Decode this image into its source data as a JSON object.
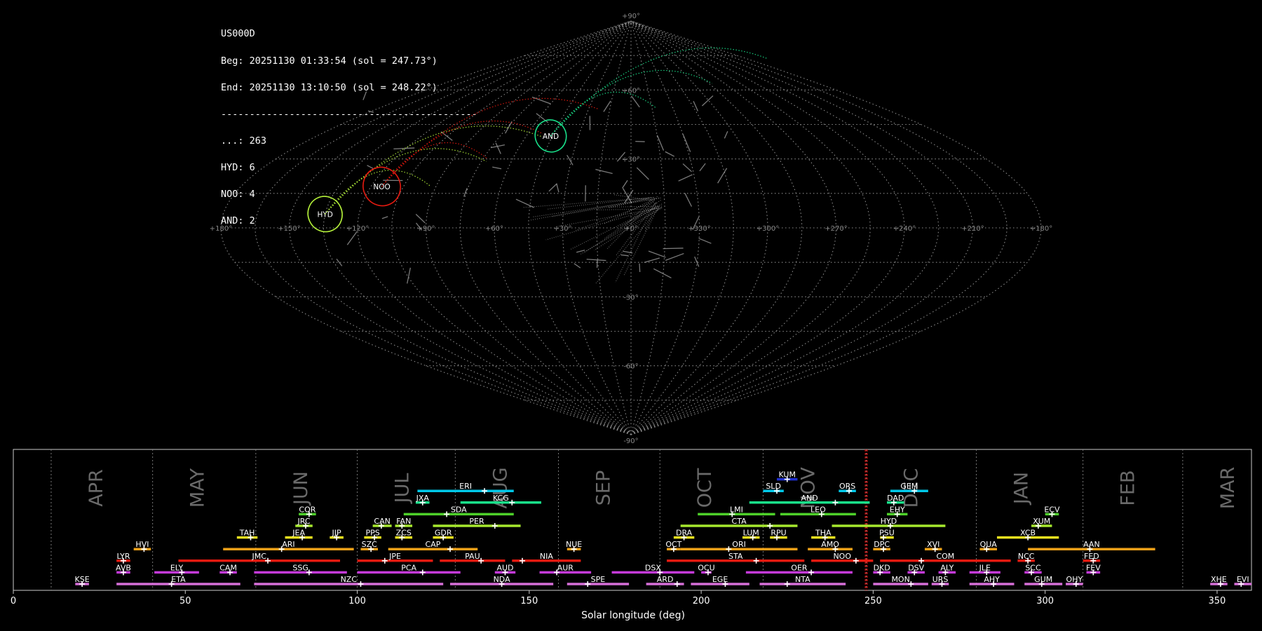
{
  "info": {
    "station": "US000D",
    "beg": "Beg: 20251130 01:33:54 (sol = 247.73°)",
    "end": "End: 20251130 13:10:50 (sol = 248.22°)",
    "separator": "---------------------------------------------",
    "counts": [
      "...: 263",
      "HYD: 6",
      "NOO: 4",
      "AND: 2"
    ]
  },
  "colors": {
    "background": "#000000",
    "grid": "#8a8a8a",
    "hyd": "#b5f23a",
    "noo": "#e51a10",
    "and": "#19e08a",
    "sporadic": "#9a9a9a"
  },
  "chart_data": [
    {
      "type": "scatter",
      "projection": "sinusoidal",
      "lon_ticks": [
        "+180°",
        "+150°",
        "+120°",
        "+90°",
        "+60°",
        "+30°",
        "+0°",
        "+330°",
        "+300°",
        "+270°",
        "+240°",
        "+210°",
        "+180°"
      ],
      "lat_ticks": [
        "+90°",
        "+60°",
        "+30°",
        "-30°",
        "-60°",
        "-90°"
      ],
      "grid": true,
      "showers": [
        {
          "code": "HYD",
          "lon": 135,
          "lat": 6,
          "radius": 11,
          "color": "#b5f23a",
          "count": 6
        },
        {
          "code": "NOO",
          "lon": 115,
          "lat": 18,
          "radius": 12,
          "color": "#e51a10",
          "count": 4
        },
        {
          "code": "AND",
          "lon": 46,
          "lat": 40,
          "radius": 10,
          "color": "#19e08a",
          "count": 2
        }
      ]
    },
    {
      "type": "timeline",
      "xlabel": "Solar longitude (deg)",
      "xlim": [
        0,
        360
      ],
      "x_ticks": [
        0,
        50,
        100,
        150,
        200,
        250,
        300,
        350
      ],
      "current_sol": [
        247.73,
        248.22
      ],
      "months": [
        {
          "name": "APR",
          "start": 11
        },
        {
          "name": "MAY",
          "start": 40.5
        },
        {
          "name": "JUN",
          "start": 70.5
        },
        {
          "name": "JUL",
          "start": 100
        },
        {
          "name": "AUG",
          "start": 128.5
        },
        {
          "name": "SEP",
          "start": 158.5
        },
        {
          "name": "OCT",
          "start": 188
        },
        {
          "name": "NOV",
          "start": 218
        },
        {
          "name": "DEC",
          "start": 248
        },
        {
          "name": "JAN",
          "start": 280
        },
        {
          "name": "FEB",
          "start": 311
        },
        {
          "name": "MAR",
          "start": 340
        }
      ],
      "showers": [
        {
          "code": "KUM",
          "row": 9,
          "start": 222,
          "end": 228,
          "peak": 225,
          "color": "#1f2fd0"
        },
        {
          "code": "ERI",
          "row": 8,
          "start": 117.5,
          "end": 145.5,
          "peak": 137,
          "color": "#00c8e8"
        },
        {
          "code": "SLD",
          "row": 8,
          "start": 218,
          "end": 224,
          "peak": 222,
          "color": "#00c8e8"
        },
        {
          "code": "ORS",
          "row": 8,
          "start": 240,
          "end": 245,
          "peak": 243,
          "color": "#00c8e8"
        },
        {
          "code": "GEM",
          "row": 8,
          "start": 255,
          "end": 266,
          "peak": 262,
          "color": "#00c8e8"
        },
        {
          "code": "JXA",
          "row": 7,
          "start": 117,
          "end": 121,
          "peak": 119,
          "color": "#19e08a"
        },
        {
          "code": "KCG",
          "row": 7,
          "start": 130,
          "end": 153.5,
          "peak": 145,
          "color": "#19e08a"
        },
        {
          "code": "AND",
          "row": 7,
          "start": 214,
          "end": 249,
          "peak": 239,
          "color": "#19e08a"
        },
        {
          "code": "DAD",
          "row": 7,
          "start": 254,
          "end": 259,
          "peak": 256,
          "color": "#19e08a"
        },
        {
          "code": "COR",
          "row": 6,
          "start": 83,
          "end": 88,
          "peak": 86,
          "color": "#4ed12a"
        },
        {
          "code": "SDA",
          "row": 6,
          "start": 113.5,
          "end": 145.5,
          "peak": 126,
          "color": "#4ed12a"
        },
        {
          "code": "LMI",
          "row": 6,
          "start": 199,
          "end": 221.5,
          "peak": 209,
          "color": "#4ed12a"
        },
        {
          "code": "LEO",
          "row": 6,
          "start": 223,
          "end": 245,
          "peak": 235,
          "color": "#4ed12a"
        },
        {
          "code": "EHY",
          "row": 6,
          "start": 254,
          "end": 260,
          "peak": 257,
          "color": "#4ed12a"
        },
        {
          "code": "ECV",
          "row": 6,
          "start": 300,
          "end": 304,
          "peak": 302,
          "color": "#4ed12a"
        },
        {
          "code": "JRC",
          "row": 5,
          "start": 82,
          "end": 87,
          "peak": 85,
          "color": "#a6e82e"
        },
        {
          "code": "CAN",
          "row": 5,
          "start": 104.5,
          "end": 110,
          "peak": 107,
          "color": "#a6e82e"
        },
        {
          "code": "FAN",
          "row": 5,
          "start": 111,
          "end": 116,
          "peak": 113,
          "color": "#a6e82e"
        },
        {
          "code": "PER",
          "row": 5,
          "start": 122,
          "end": 147.5,
          "peak": 140,
          "color": "#a6e82e"
        },
        {
          "code": "CTA",
          "row": 5,
          "start": 194,
          "end": 228,
          "peak": 220,
          "color": "#a6e82e"
        },
        {
          "code": "HYD",
          "row": 5,
          "start": 238,
          "end": 271,
          "peak": 255,
          "color": "#a6e82e"
        },
        {
          "code": "XUM",
          "row": 5,
          "start": 296,
          "end": 302,
          "peak": 298,
          "color": "#a6e82e"
        },
        {
          "code": "TAH",
          "row": 4,
          "start": 65,
          "end": 71,
          "peak": 69,
          "color": "#e8e01e"
        },
        {
          "code": "JEA",
          "row": 4,
          "start": 79,
          "end": 87,
          "peak": 84,
          "color": "#e8e01e"
        },
        {
          "code": "JJP",
          "row": 4,
          "start": 92,
          "end": 96,
          "peak": 94,
          "color": "#e8e01e"
        },
        {
          "code": "PPS",
          "row": 4,
          "start": 102,
          "end": 107,
          "peak": 105,
          "color": "#e8e01e"
        },
        {
          "code": "ZCS",
          "row": 4,
          "start": 111,
          "end": 116,
          "peak": 113,
          "color": "#e8e01e"
        },
        {
          "code": "GDR",
          "row": 4,
          "start": 122,
          "end": 128,
          "peak": 125,
          "color": "#e8e01e"
        },
        {
          "code": "DRA",
          "row": 4,
          "start": 192,
          "end": 198,
          "peak": 195,
          "color": "#e8e01e"
        },
        {
          "code": "LUM",
          "row": 4,
          "start": 212,
          "end": 217,
          "peak": 215,
          "color": "#e8e01e"
        },
        {
          "code": "RPU",
          "row": 4,
          "start": 220,
          "end": 225,
          "peak": 222,
          "color": "#e8e01e"
        },
        {
          "code": "THA",
          "row": 4,
          "start": 232,
          "end": 239,
          "peak": 236,
          "color": "#e8e01e"
        },
        {
          "code": "PSU",
          "row": 4,
          "start": 252,
          "end": 256,
          "peak": 253,
          "color": "#e8e01e"
        },
        {
          "code": "XCB",
          "row": 4,
          "start": 286,
          "end": 304,
          "peak": 295,
          "color": "#e8e01e"
        },
        {
          "code": "HVI",
          "row": 3,
          "start": 35,
          "end": 40,
          "peak": 38,
          "color": "#f0a018"
        },
        {
          "code": "ARI",
          "row": 3,
          "start": 61,
          "end": 99,
          "peak": 78,
          "color": "#f0a018"
        },
        {
          "code": "SZC",
          "row": 3,
          "start": 101,
          "end": 106,
          "peak": 104,
          "color": "#f0a018"
        },
        {
          "code": "CAP",
          "row": 3,
          "start": 109,
          "end": 135,
          "peak": 127,
          "color": "#f0a018"
        },
        {
          "code": "NUE",
          "row": 3,
          "start": 161,
          "end": 165,
          "peak": 163,
          "color": "#f0a018"
        },
        {
          "code": "OCT",
          "row": 3,
          "start": 190,
          "end": 194,
          "peak": 192,
          "color": "#f0a018"
        },
        {
          "code": "ORI",
          "row": 3,
          "start": 194,
          "end": 228,
          "peak": 208,
          "color": "#f0a018"
        },
        {
          "code": "AMO",
          "row": 3,
          "start": 231,
          "end": 244,
          "peak": 239,
          "color": "#f0a018"
        },
        {
          "code": "DPC",
          "row": 3,
          "start": 250,
          "end": 255,
          "peak": 253,
          "color": "#f0a018"
        },
        {
          "code": "XVI",
          "row": 3,
          "start": 265,
          "end": 270,
          "peak": 268,
          "color": "#f0a018"
        },
        {
          "code": "QUA",
          "row": 3,
          "start": 281,
          "end": 286,
          "peak": 283,
          "color": "#f0a018"
        },
        {
          "code": "AAN",
          "row": 3,
          "start": 295,
          "end": 332,
          "peak": 313,
          "color": "#f0a018"
        },
        {
          "code": "LYR",
          "row": 2,
          "start": 30,
          "end": 34,
          "peak": 32,
          "color": "#e51a10"
        },
        {
          "code": "JMC",
          "row": 2,
          "start": 48,
          "end": 95,
          "peak": 74,
          "color": "#e51a10"
        },
        {
          "code": "JPE",
          "row": 2,
          "start": 100,
          "end": 122,
          "peak": 108,
          "color": "#e51a10"
        },
        {
          "code": "PAU",
          "row": 2,
          "start": 124,
          "end": 143,
          "peak": 136,
          "color": "#e51a10"
        },
        {
          "code": "NIA",
          "row": 2,
          "start": 145,
          "end": 165,
          "peak": 148,
          "color": "#e51a10"
        },
        {
          "code": "STA",
          "row": 2,
          "start": 190,
          "end": 230,
          "peak": 216,
          "color": "#e51a10"
        },
        {
          "code": "NOO",
          "row": 2,
          "start": 232,
          "end": 250,
          "peak": 245,
          "color": "#e51a10"
        },
        {
          "code": "COM",
          "row": 2,
          "start": 252,
          "end": 290,
          "peak": 264,
          "color": "#e51a10"
        },
        {
          "code": "NCC",
          "row": 2,
          "start": 292,
          "end": 297,
          "peak": 295,
          "color": "#e51a10"
        },
        {
          "code": "FED",
          "row": 2,
          "start": 311,
          "end": 316,
          "peak": 314,
          "color": "#e51a10"
        },
        {
          "code": "AVB",
          "row": 1,
          "start": 30,
          "end": 34,
          "peak": 32,
          "color": "#c43ad8"
        },
        {
          "code": "ELY",
          "row": 1,
          "start": 41,
          "end": 54,
          "peak": 49,
          "color": "#c43ad8"
        },
        {
          "code": "CAM",
          "row": 1,
          "start": 60,
          "end": 65,
          "peak": 63,
          "color": "#c43ad8"
        },
        {
          "code": "SSG",
          "row": 1,
          "start": 70,
          "end": 97,
          "peak": 86,
          "color": "#c43ad8"
        },
        {
          "code": "PCA",
          "row": 1,
          "start": 100,
          "end": 130,
          "peak": 119,
          "color": "#c43ad8"
        },
        {
          "code": "AUD",
          "row": 1,
          "start": 140,
          "end": 146,
          "peak": 143,
          "color": "#c43ad8"
        },
        {
          "code": "AUR",
          "row": 1,
          "start": 153,
          "end": 168,
          "peak": 158,
          "color": "#c43ad8"
        },
        {
          "code": "DSX",
          "row": 1,
          "start": 174,
          "end": 198,
          "peak": 188,
          "color": "#c43ad8"
        },
        {
          "code": "OCU",
          "row": 1,
          "start": 200,
          "end": 203,
          "peak": 202,
          "color": "#c43ad8"
        },
        {
          "code": "OER",
          "row": 1,
          "start": 213,
          "end": 244,
          "peak": 232,
          "color": "#c43ad8"
        },
        {
          "code": "DKD",
          "row": 1,
          "start": 250,
          "end": 255,
          "peak": 252,
          "color": "#c43ad8"
        },
        {
          "code": "DSV",
          "row": 1,
          "start": 260,
          "end": 265,
          "peak": 262,
          "color": "#c43ad8"
        },
        {
          "code": "ALY",
          "row": 1,
          "start": 269,
          "end": 274,
          "peak": 271,
          "color": "#c43ad8"
        },
        {
          "code": "JLE",
          "row": 1,
          "start": 278,
          "end": 287,
          "peak": 283,
          "color": "#c43ad8"
        },
        {
          "code": "SCC",
          "row": 1,
          "start": 294,
          "end": 299,
          "peak": 296,
          "color": "#c43ad8"
        },
        {
          "code": "FEV",
          "row": 1,
          "start": 312,
          "end": 316,
          "peak": 314,
          "color": "#c43ad8"
        },
        {
          "code": "KSE",
          "row": 0,
          "start": 18,
          "end": 22,
          "peak": 20,
          "color": "#d66ed8"
        },
        {
          "code": "ETA",
          "row": 0,
          "start": 30,
          "end": 66,
          "peak": 46,
          "color": "#d66ed8"
        },
        {
          "code": "NZC",
          "row": 0,
          "start": 70,
          "end": 125,
          "peak": 101,
          "color": "#d66ed8"
        },
        {
          "code": "NDA",
          "row": 0,
          "start": 127,
          "end": 157,
          "peak": 142,
          "color": "#d66ed8"
        },
        {
          "code": "SPE",
          "row": 0,
          "start": 161,
          "end": 179,
          "peak": 167,
          "color": "#d66ed8"
        },
        {
          "code": "ARD",
          "row": 0,
          "start": 184,
          "end": 195,
          "peak": 193,
          "color": "#d66ed8"
        },
        {
          "code": "EGE",
          "row": 0,
          "start": 197,
          "end": 214,
          "peak": 207,
          "color": "#d66ed8"
        },
        {
          "code": "NTA",
          "row": 0,
          "start": 217,
          "end": 242,
          "peak": 225,
          "color": "#d66ed8"
        },
        {
          "code": "MON",
          "row": 0,
          "start": 250,
          "end": 266,
          "peak": 261,
          "color": "#d66ed8"
        },
        {
          "code": "URS",
          "row": 0,
          "start": 267,
          "end": 272,
          "peak": 270,
          "color": "#d66ed8"
        },
        {
          "code": "AHY",
          "row": 0,
          "start": 278,
          "end": 291,
          "peak": 285,
          "color": "#d66ed8"
        },
        {
          "code": "GUM",
          "row": 0,
          "start": 294,
          "end": 305,
          "peak": 299,
          "color": "#d66ed8"
        },
        {
          "code": "OHY",
          "row": 0,
          "start": 306,
          "end": 311,
          "peak": 309,
          "color": "#d66ed8"
        },
        {
          "code": "XHE",
          "row": 0,
          "start": 348,
          "end": 353,
          "peak": 351,
          "color": "#d66ed8"
        },
        {
          "code": "EVI",
          "row": 0,
          "start": 355,
          "end": 360,
          "peak": 357,
          "color": "#d66ed8"
        }
      ]
    }
  ]
}
